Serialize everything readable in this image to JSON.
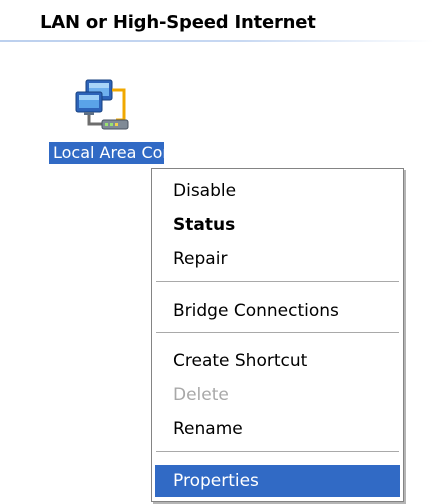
{
  "group": {
    "title": "LAN or High-Speed Internet"
  },
  "connection": {
    "icon": "network-connection-icon",
    "label": "Local Area Connection",
    "selected": true
  },
  "context_menu": {
    "items": [
      {
        "label": "Disable",
        "bold": false,
        "enabled": true,
        "highlighted": false
      },
      {
        "label": "Status",
        "bold": true,
        "enabled": true,
        "highlighted": false
      },
      {
        "label": "Repair",
        "bold": false,
        "enabled": true,
        "highlighted": false
      },
      {
        "label": "Bridge Connections",
        "bold": false,
        "enabled": true,
        "highlighted": false
      },
      {
        "label": "Create Shortcut",
        "bold": false,
        "enabled": true,
        "highlighted": false
      },
      {
        "label": "Delete",
        "bold": false,
        "enabled": false,
        "highlighted": false
      },
      {
        "label": "Rename",
        "bold": false,
        "enabled": true,
        "highlighted": false
      },
      {
        "label": "Properties",
        "bold": false,
        "enabled": true,
        "highlighted": true
      }
    ]
  },
  "colors": {
    "selection": "#316ac5",
    "disabled_text": "#a8a8a8",
    "header_rule": "#c7d8f2"
  }
}
